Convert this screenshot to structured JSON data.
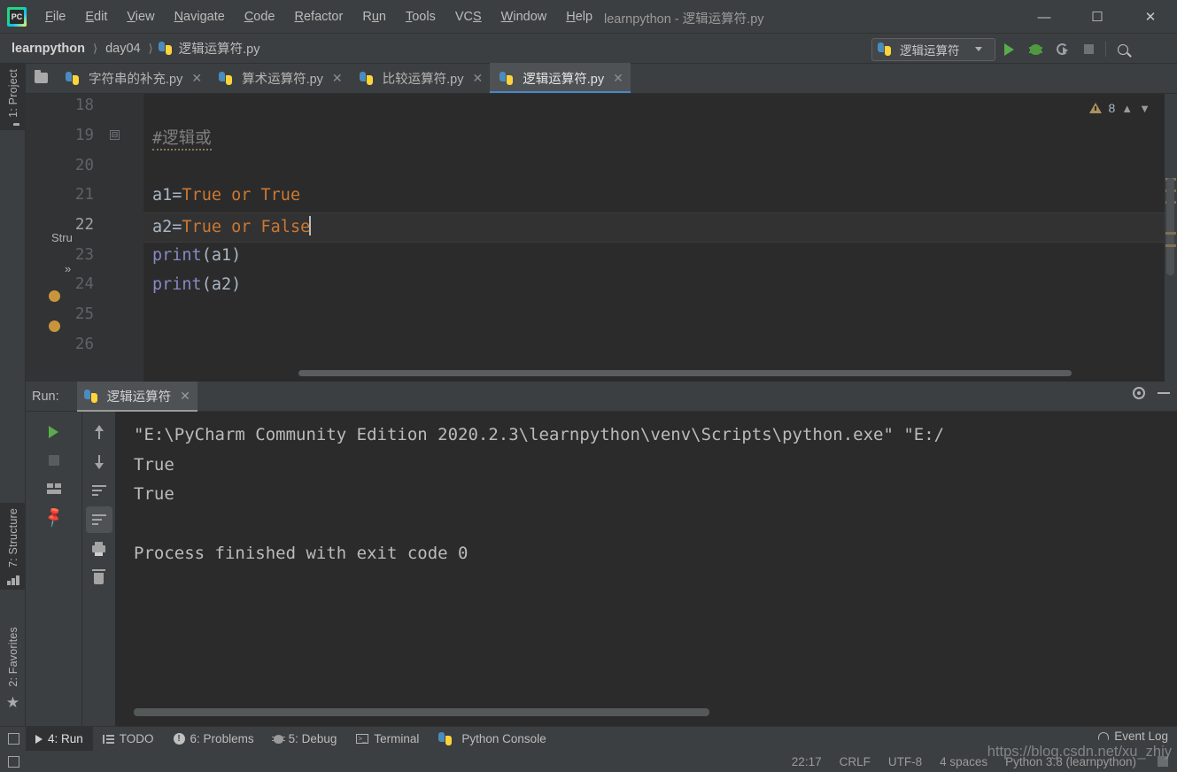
{
  "window": {
    "title": "learnpython - 逻辑运算符.py",
    "minimize": "—",
    "maximize": "▫",
    "close": "✕",
    "logo": "PC"
  },
  "menu": [
    {
      "label": "File"
    },
    {
      "label": "Edit"
    },
    {
      "label": "View"
    },
    {
      "label": "Navigate"
    },
    {
      "label": "Code"
    },
    {
      "label": "Refactor"
    },
    {
      "label": "Run"
    },
    {
      "label": "Tools"
    },
    {
      "label": "VCS"
    },
    {
      "label": "Window"
    },
    {
      "label": "Help"
    }
  ],
  "breadcrumb": {
    "items": [
      "learnpython",
      "day04",
      "逻辑运算符.py"
    ],
    "separator": "›"
  },
  "toolbar": {
    "run_config": "逻辑运算符",
    "run_tooltip": "Run",
    "debug_tooltip": "Debug",
    "coverage_tooltip": "Run with Coverage",
    "stop_tooltip": "Stop",
    "search_tooltip": "Search Everywhere"
  },
  "left_tool_tabs": [
    {
      "label": "1: Project",
      "icon": "folder-icon",
      "selected": true
    },
    {
      "label": "7: Structure",
      "icon": "structure-icon",
      "selected": true
    },
    {
      "label": "2: Favorites",
      "icon": "star-icon",
      "selected": false
    }
  ],
  "editor_tabs": [
    {
      "label": "字符串的补充.py",
      "active": false
    },
    {
      "label": "算术运算符.py",
      "active": false
    },
    {
      "label": "比较运算符.py",
      "active": false
    },
    {
      "label": "逻辑运算符.py",
      "active": true
    }
  ],
  "editor": {
    "first_line": 18,
    "current_line": 22,
    "warning_count": "8",
    "structure_label": "Stru",
    "expander": "»",
    "lines": [
      {
        "num": "18",
        "text": ""
      },
      {
        "num": "19",
        "text": "#逻辑或",
        "kind": "comment",
        "folded": true
      },
      {
        "num": "20",
        "text": ""
      },
      {
        "num": "21",
        "text": "a1=True or True"
      },
      {
        "num": "22",
        "text": "a2=True or False",
        "current": true
      },
      {
        "num": "23",
        "text": "print(a1)"
      },
      {
        "num": "24",
        "text": "print(a2)"
      },
      {
        "num": "25",
        "text": ""
      },
      {
        "num": "26",
        "text": ""
      }
    ],
    "code": {
      "l19_comment": "#逻辑或",
      "l21_var": "a1=",
      "l21_expr": "True or True",
      "l22_var": "a2=",
      "l22_expr": "True or False",
      "l23_fn": "print",
      "l23_args": "(a1)",
      "l24_fn": "print",
      "l24_args": "(a2)"
    }
  },
  "run_window": {
    "label": "Run:",
    "tab": "逻辑运算符",
    "settings_tooltip": "Settings",
    "hide_tooltip": "Hide",
    "console_lines": [
      "\"E:\\PyCharm Community Edition 2020.2.3\\learnpython\\venv\\Scripts\\python.exe\" \"E:/",
      "True",
      "True",
      "",
      "Process finished with exit code 0"
    ],
    "toolbar_left": [
      "rerun-icon",
      "stop-icon",
      "layout-icon",
      "pin-icon"
    ],
    "toolbar_right": [
      "up-icon",
      "down-icon",
      "soft-wrap-icon",
      "scroll-to-end-icon",
      "print-icon",
      "clear-all-icon"
    ]
  },
  "bottom_tabs": [
    {
      "label": "4: Run",
      "icon": "run-icon",
      "active": true
    },
    {
      "label": "TODO",
      "icon": "todo-icon",
      "active": false
    },
    {
      "label": "6: Problems",
      "icon": "problems-icon",
      "active": false
    },
    {
      "label": "5: Debug",
      "icon": "debug-icon",
      "active": false
    },
    {
      "label": "Terminal",
      "icon": "terminal-icon",
      "active": false
    },
    {
      "label": "Python Console",
      "icon": "python-icon",
      "active": false
    }
  ],
  "status_bar": {
    "event_log": "Event Log",
    "caret_position": "22:17",
    "line_separator": "CRLF",
    "encoding": "UTF-8",
    "indent": "4 spaces",
    "interpreter": "Python 3.8 (learnpython)"
  },
  "watermark": "https://blog.csdn.net/xu_zhiy",
  "colors": {
    "background": "#3c3f41",
    "editor_bg": "#2b2b2b",
    "gutter_bg": "#313335",
    "accent_blue": "#4a88c7",
    "run_green": "#5aab4e",
    "keyword_orange": "#cc7832",
    "function_blue": "#8888c6",
    "variable": "#a9b7c6",
    "comment_gray": "#808080",
    "warning_yellow": "#a9925c"
  }
}
